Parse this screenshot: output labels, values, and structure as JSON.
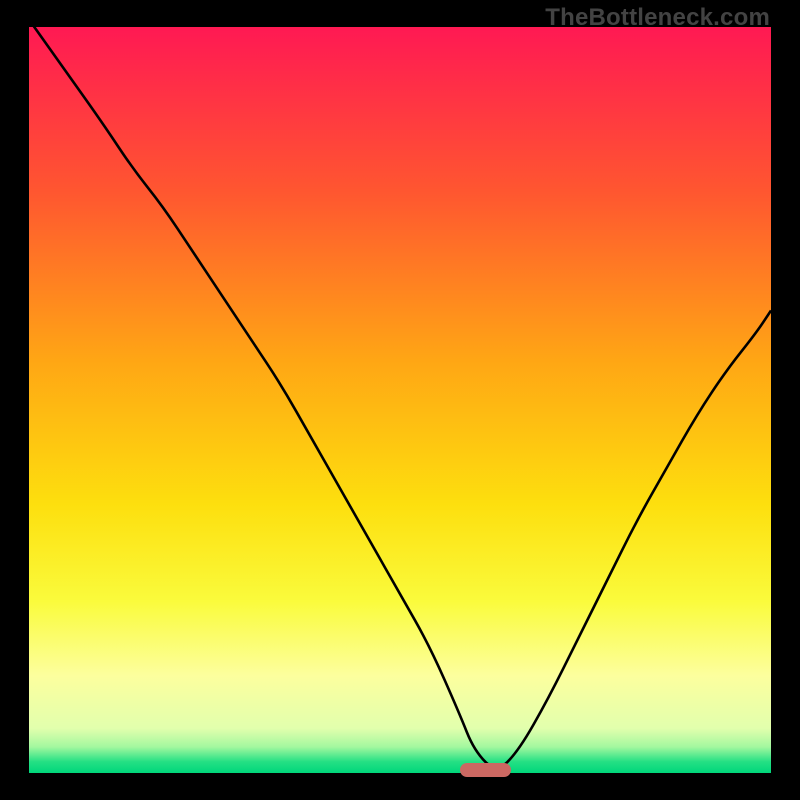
{
  "watermark": "TheBottleneck.com",
  "chart_data": {
    "type": "line",
    "title": "",
    "xlabel": "",
    "ylabel": "",
    "xlim": [
      0,
      100
    ],
    "ylim": [
      0,
      100
    ],
    "grid": false,
    "legend": false,
    "background_gradient_stops": [
      {
        "pos": 0.0,
        "color": "#ff1953"
      },
      {
        "pos": 0.22,
        "color": "#ff5630"
      },
      {
        "pos": 0.45,
        "color": "#ffa714"
      },
      {
        "pos": 0.64,
        "color": "#fddf0e"
      },
      {
        "pos": 0.77,
        "color": "#fafb3c"
      },
      {
        "pos": 0.87,
        "color": "#fcff9e"
      },
      {
        "pos": 0.94,
        "color": "#e2ffad"
      },
      {
        "pos": 0.965,
        "color": "#a3f89f"
      },
      {
        "pos": 0.985,
        "color": "#24e084"
      },
      {
        "pos": 1.0,
        "color": "#00d67b"
      }
    ],
    "series": [
      {
        "name": "bottleneck-curve",
        "color": "#000000",
        "x": [
          0,
          5,
          10,
          14,
          18,
          22,
          26,
          30,
          34,
          38,
          42,
          46,
          50,
          54,
          58,
          60,
          63,
          66,
          70,
          74,
          78,
          82,
          86,
          90,
          94,
          98,
          100
        ],
        "y": [
          101,
          94,
          87,
          81,
          76,
          70,
          64,
          58,
          52,
          45,
          38,
          31,
          24,
          17,
          8,
          3,
          0,
          3,
          10,
          18,
          26,
          34,
          41,
          48,
          54,
          59,
          62
        ]
      }
    ],
    "marker": {
      "x_center": 61.5,
      "y": 0.4,
      "width": 6.8,
      "height": 1.8,
      "color": "#cb6862"
    }
  }
}
